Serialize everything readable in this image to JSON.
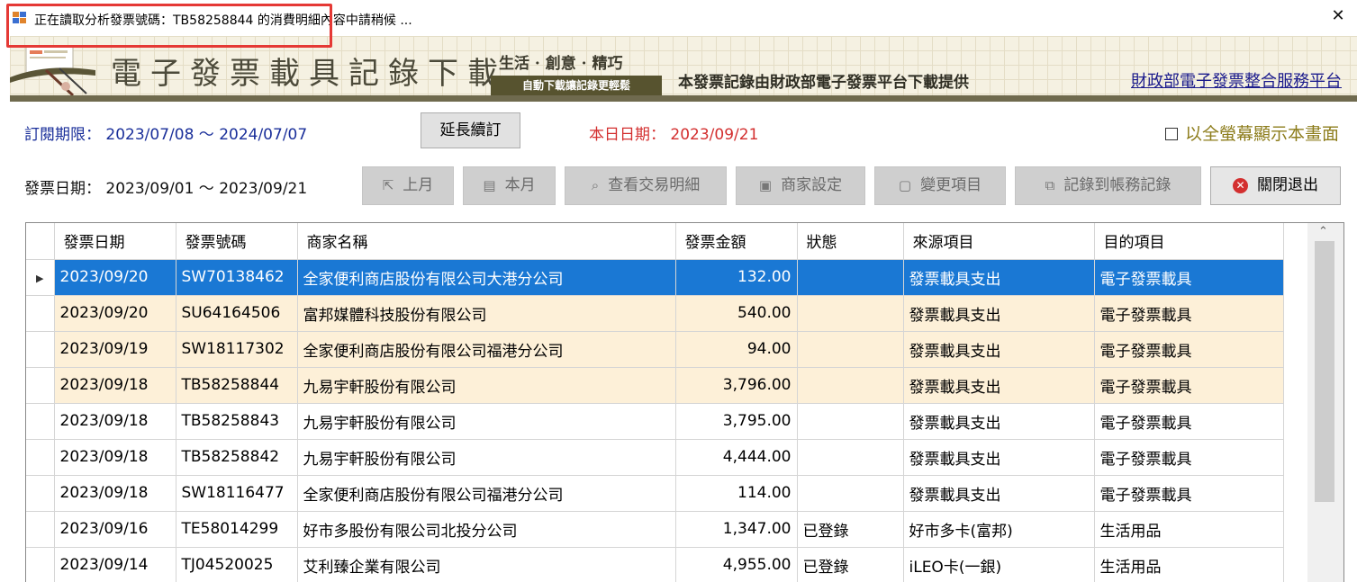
{
  "window": {
    "title": "正在讀取分析發票號碼：TB58258844 的消費明細內容中請稍候 ..."
  },
  "banner": {
    "title": "電子發票載具記錄下載",
    "slogan": "生活 · 創意 · 精巧",
    "subslogan": "自動下載讓記錄更輕鬆",
    "provider": "本發票記錄由財政部電子發票平台下載提供",
    "link": "財政部電子發票整合服務平台"
  },
  "subscription": {
    "label": "訂閱期限：",
    "range": "2023/07/08 ～ 2024/07/07",
    "extend_button": "延長續訂",
    "today_label": "本日日期：",
    "today_value": "2023/09/21",
    "fullscreen_label": "以全螢幕顯示本畫面"
  },
  "invoice_range": {
    "label": "發票日期：",
    "range": "2023/09/01 ～ 2023/09/21"
  },
  "toolbar": {
    "prev_month": "上月",
    "this_month": "本月",
    "view_details": "查看交易明細",
    "merchant_settings": "商家設定",
    "change_item": "變更項目",
    "record_to_ledger": "記錄到帳務記錄",
    "close_exit": "關閉退出"
  },
  "table": {
    "headers": [
      "發票日期",
      "發票號碼",
      "商家名稱",
      "發票金額",
      "狀態",
      "來源項目",
      "目的項目"
    ],
    "rows": [
      [
        "2023/09/20",
        "SW70138462",
        "全家便利商店股份有限公司大港分公司",
        "132.00",
        "",
        "發票載具支出",
        "電子發票載具"
      ],
      [
        "2023/09/20",
        "SU64164506",
        "富邦媒體科技股份有限公司",
        "540.00",
        "",
        "發票載具支出",
        "電子發票載具"
      ],
      [
        "2023/09/19",
        "SW18117302",
        "全家便利商店股份有限公司福港分公司",
        "94.00",
        "",
        "發票載具支出",
        "電子發票載具"
      ],
      [
        "2023/09/18",
        "TB58258844",
        "九易宇軒股份有限公司",
        "3,796.00",
        "",
        "發票載具支出",
        "電子發票載具"
      ],
      [
        "2023/09/18",
        "TB58258843",
        "九易宇軒股份有限公司",
        "3,795.00",
        "",
        "發票載具支出",
        "電子發票載具"
      ],
      [
        "2023/09/18",
        "TB58258842",
        "九易宇軒股份有限公司",
        "4,444.00",
        "",
        "發票載具支出",
        "電子發票載具"
      ],
      [
        "2023/09/18",
        "SW18116477",
        "全家便利商店股份有限公司福港分公司",
        "114.00",
        "",
        "發票載具支出",
        "電子發票載具"
      ],
      [
        "2023/09/16",
        "TE58014299",
        "好市多股份有限公司北投分公司",
        "1,347.00",
        "已登錄",
        "好市多卡(富邦)",
        "生活用品"
      ],
      [
        "2023/09/14",
        "TJ04520025",
        "艾利臻企業有限公司",
        "4,955.00",
        "已登錄",
        "iLEO卡(一銀)",
        "生活用品"
      ]
    ]
  },
  "colors": {
    "selected_row": "#1a78d4",
    "highlight_row": "#fdf0d8",
    "annotation_box": "#e53935"
  }
}
